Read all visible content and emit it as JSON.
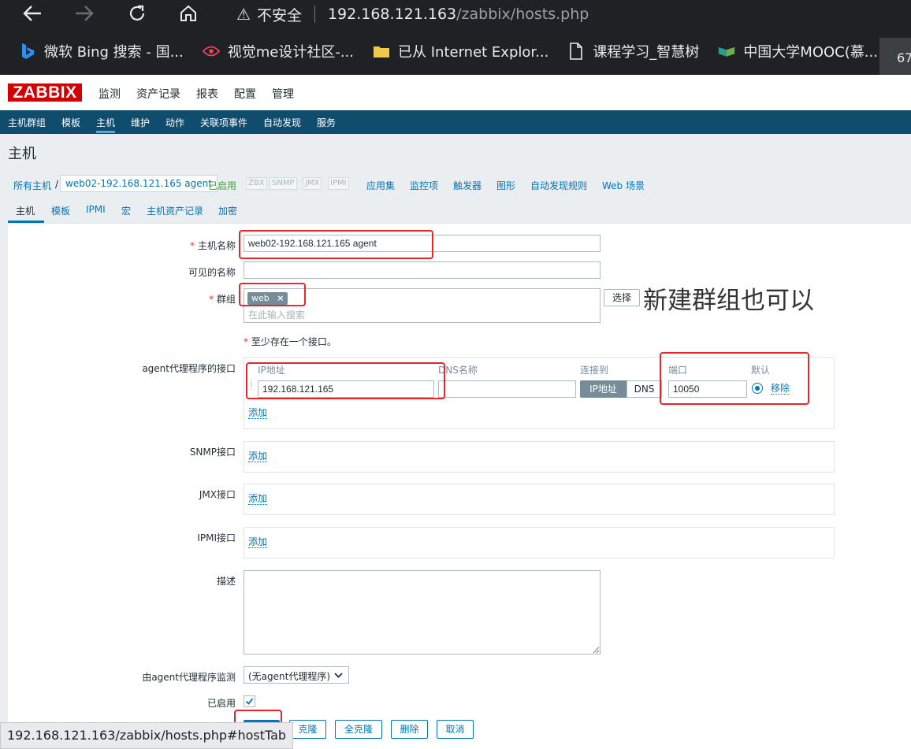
{
  "browser": {
    "insecure_label": "不安全",
    "url_host": "192.168.121.163",
    "url_path": "/zabbix/hosts.php",
    "bookmarks": [
      {
        "icon": "bing-icon",
        "label": "微软 Bing 搜索 - 国..."
      },
      {
        "icon": "eye-logo-icon",
        "label": "视觉me设计社区-..."
      },
      {
        "icon": "folder-icon",
        "label": "已从 Internet Explor..."
      },
      {
        "icon": "page-icon",
        "label": "课程学习_智慧树"
      },
      {
        "icon": "mooc-icon",
        "label": "中国大学MOOC(慕..."
      }
    ],
    "tooltip_fragment": "67",
    "status_url": "192.168.121.163/zabbix/hosts.php#hostTab"
  },
  "header": {
    "logo": "ZABBIX",
    "menu": [
      "监测",
      "资产记录",
      "报表",
      "配置",
      "管理"
    ],
    "active_menu": "配置"
  },
  "subnav": {
    "items": [
      "主机群组",
      "模板",
      "主机",
      "维护",
      "动作",
      "关联项事件",
      "自动发现",
      "服务"
    ],
    "active": "主机"
  },
  "page_title": "主机",
  "breadcrumb": {
    "all_hosts": "所有主机",
    "separator": "/",
    "current_host": "web02-192.168.121.165 agent",
    "enabled": "已启用",
    "availability": [
      "ZBX",
      "SNMP",
      "JMX",
      "IPMI"
    ],
    "links": [
      "应用集",
      "监控项",
      "触发器",
      "图形",
      "自动发现规则",
      "Web 场景"
    ]
  },
  "tabs": [
    "主机",
    "模板",
    "IPMI",
    "宏",
    "主机资产记录",
    "加密"
  ],
  "form": {
    "host_name_label": "主机名称",
    "host_name_value": "web02-192.168.121.165 agent",
    "visible_name_label": "可见的名称",
    "visible_name_value": "",
    "groups_label": "群组",
    "group_tag": "web",
    "group_search_placeholder": "在此输入搜索",
    "select_button": "选择",
    "interface_note": "至少存在一个接口。",
    "agent_interface_label": "agent代理程序的接口",
    "col_ip": "IP地址",
    "col_dns": "DNS名称",
    "col_connect": "连接到",
    "col_port": "端口",
    "col_default": "默认",
    "ip_value": "192.168.121.165",
    "dns_value": "",
    "connect_ip": "IP地址",
    "connect_dns": "DNS",
    "port_value": "10050",
    "remove_link": "移除",
    "add_link": "添加",
    "snmp_label": "SNMP接口",
    "jmx_label": "JMX接口",
    "ipmi_label": "IPMI接口",
    "description_label": "描述",
    "description_value": "",
    "proxy_label": "由agent代理程序监测",
    "proxy_value": "(无agent代理程序)",
    "enabled_label": "已启用",
    "enabled_checked": true,
    "buttons": {
      "clone": "克隆",
      "full_clone": "全克隆",
      "delete": "删除",
      "cancel": "取消"
    }
  },
  "annotation": "新建群组也可以"
}
